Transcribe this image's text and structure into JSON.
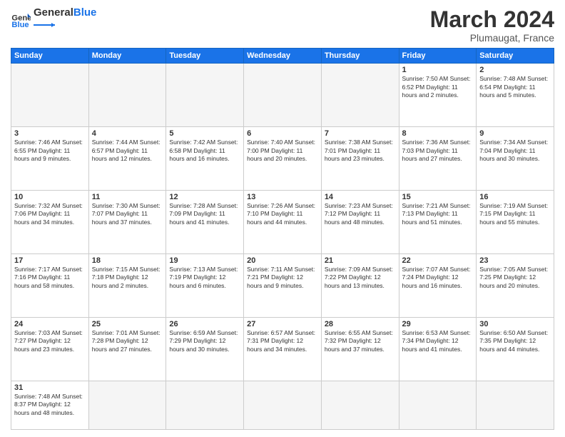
{
  "header": {
    "logo_general": "General",
    "logo_blue": "Blue",
    "month": "March 2024",
    "location": "Plumaugat, France"
  },
  "weekdays": [
    "Sunday",
    "Monday",
    "Tuesday",
    "Wednesday",
    "Thursday",
    "Friday",
    "Saturday"
  ],
  "weeks": [
    [
      {
        "day": "",
        "info": ""
      },
      {
        "day": "",
        "info": ""
      },
      {
        "day": "",
        "info": ""
      },
      {
        "day": "",
        "info": ""
      },
      {
        "day": "",
        "info": ""
      },
      {
        "day": "1",
        "info": "Sunrise: 7:50 AM\nSunset: 6:52 PM\nDaylight: 11 hours\nand 2 minutes."
      },
      {
        "day": "2",
        "info": "Sunrise: 7:48 AM\nSunset: 6:54 PM\nDaylight: 11 hours\nand 5 minutes."
      }
    ],
    [
      {
        "day": "3",
        "info": "Sunrise: 7:46 AM\nSunset: 6:55 PM\nDaylight: 11 hours\nand 9 minutes."
      },
      {
        "day": "4",
        "info": "Sunrise: 7:44 AM\nSunset: 6:57 PM\nDaylight: 11 hours\nand 12 minutes."
      },
      {
        "day": "5",
        "info": "Sunrise: 7:42 AM\nSunset: 6:58 PM\nDaylight: 11 hours\nand 16 minutes."
      },
      {
        "day": "6",
        "info": "Sunrise: 7:40 AM\nSunset: 7:00 PM\nDaylight: 11 hours\nand 20 minutes."
      },
      {
        "day": "7",
        "info": "Sunrise: 7:38 AM\nSunset: 7:01 PM\nDaylight: 11 hours\nand 23 minutes."
      },
      {
        "day": "8",
        "info": "Sunrise: 7:36 AM\nSunset: 7:03 PM\nDaylight: 11 hours\nand 27 minutes."
      },
      {
        "day": "9",
        "info": "Sunrise: 7:34 AM\nSunset: 7:04 PM\nDaylight: 11 hours\nand 30 minutes."
      }
    ],
    [
      {
        "day": "10",
        "info": "Sunrise: 7:32 AM\nSunset: 7:06 PM\nDaylight: 11 hours\nand 34 minutes."
      },
      {
        "day": "11",
        "info": "Sunrise: 7:30 AM\nSunset: 7:07 PM\nDaylight: 11 hours\nand 37 minutes."
      },
      {
        "day": "12",
        "info": "Sunrise: 7:28 AM\nSunset: 7:09 PM\nDaylight: 11 hours\nand 41 minutes."
      },
      {
        "day": "13",
        "info": "Sunrise: 7:26 AM\nSunset: 7:10 PM\nDaylight: 11 hours\nand 44 minutes."
      },
      {
        "day": "14",
        "info": "Sunrise: 7:23 AM\nSunset: 7:12 PM\nDaylight: 11 hours\nand 48 minutes."
      },
      {
        "day": "15",
        "info": "Sunrise: 7:21 AM\nSunset: 7:13 PM\nDaylight: 11 hours\nand 51 minutes."
      },
      {
        "day": "16",
        "info": "Sunrise: 7:19 AM\nSunset: 7:15 PM\nDaylight: 11 hours\nand 55 minutes."
      }
    ],
    [
      {
        "day": "17",
        "info": "Sunrise: 7:17 AM\nSunset: 7:16 PM\nDaylight: 11 hours\nand 58 minutes."
      },
      {
        "day": "18",
        "info": "Sunrise: 7:15 AM\nSunset: 7:18 PM\nDaylight: 12 hours\nand 2 minutes."
      },
      {
        "day": "19",
        "info": "Sunrise: 7:13 AM\nSunset: 7:19 PM\nDaylight: 12 hours\nand 6 minutes."
      },
      {
        "day": "20",
        "info": "Sunrise: 7:11 AM\nSunset: 7:21 PM\nDaylight: 12 hours\nand 9 minutes."
      },
      {
        "day": "21",
        "info": "Sunrise: 7:09 AM\nSunset: 7:22 PM\nDaylight: 12 hours\nand 13 minutes."
      },
      {
        "day": "22",
        "info": "Sunrise: 7:07 AM\nSunset: 7:24 PM\nDaylight: 12 hours\nand 16 minutes."
      },
      {
        "day": "23",
        "info": "Sunrise: 7:05 AM\nSunset: 7:25 PM\nDaylight: 12 hours\nand 20 minutes."
      }
    ],
    [
      {
        "day": "24",
        "info": "Sunrise: 7:03 AM\nSunset: 7:27 PM\nDaylight: 12 hours\nand 23 minutes."
      },
      {
        "day": "25",
        "info": "Sunrise: 7:01 AM\nSunset: 7:28 PM\nDaylight: 12 hours\nand 27 minutes."
      },
      {
        "day": "26",
        "info": "Sunrise: 6:59 AM\nSunset: 7:29 PM\nDaylight: 12 hours\nand 30 minutes."
      },
      {
        "day": "27",
        "info": "Sunrise: 6:57 AM\nSunset: 7:31 PM\nDaylight: 12 hours\nand 34 minutes."
      },
      {
        "day": "28",
        "info": "Sunrise: 6:55 AM\nSunset: 7:32 PM\nDaylight: 12 hours\nand 37 minutes."
      },
      {
        "day": "29",
        "info": "Sunrise: 6:53 AM\nSunset: 7:34 PM\nDaylight: 12 hours\nand 41 minutes."
      },
      {
        "day": "30",
        "info": "Sunrise: 6:50 AM\nSunset: 7:35 PM\nDaylight: 12 hours\nand 44 minutes."
      }
    ],
    [
      {
        "day": "31",
        "info": "Sunrise: 7:48 AM\nSunset: 8:37 PM\nDaylight: 12 hours\nand 48 minutes."
      },
      {
        "day": "",
        "info": ""
      },
      {
        "day": "",
        "info": ""
      },
      {
        "day": "",
        "info": ""
      },
      {
        "day": "",
        "info": ""
      },
      {
        "day": "",
        "info": ""
      },
      {
        "day": "",
        "info": ""
      }
    ]
  ]
}
